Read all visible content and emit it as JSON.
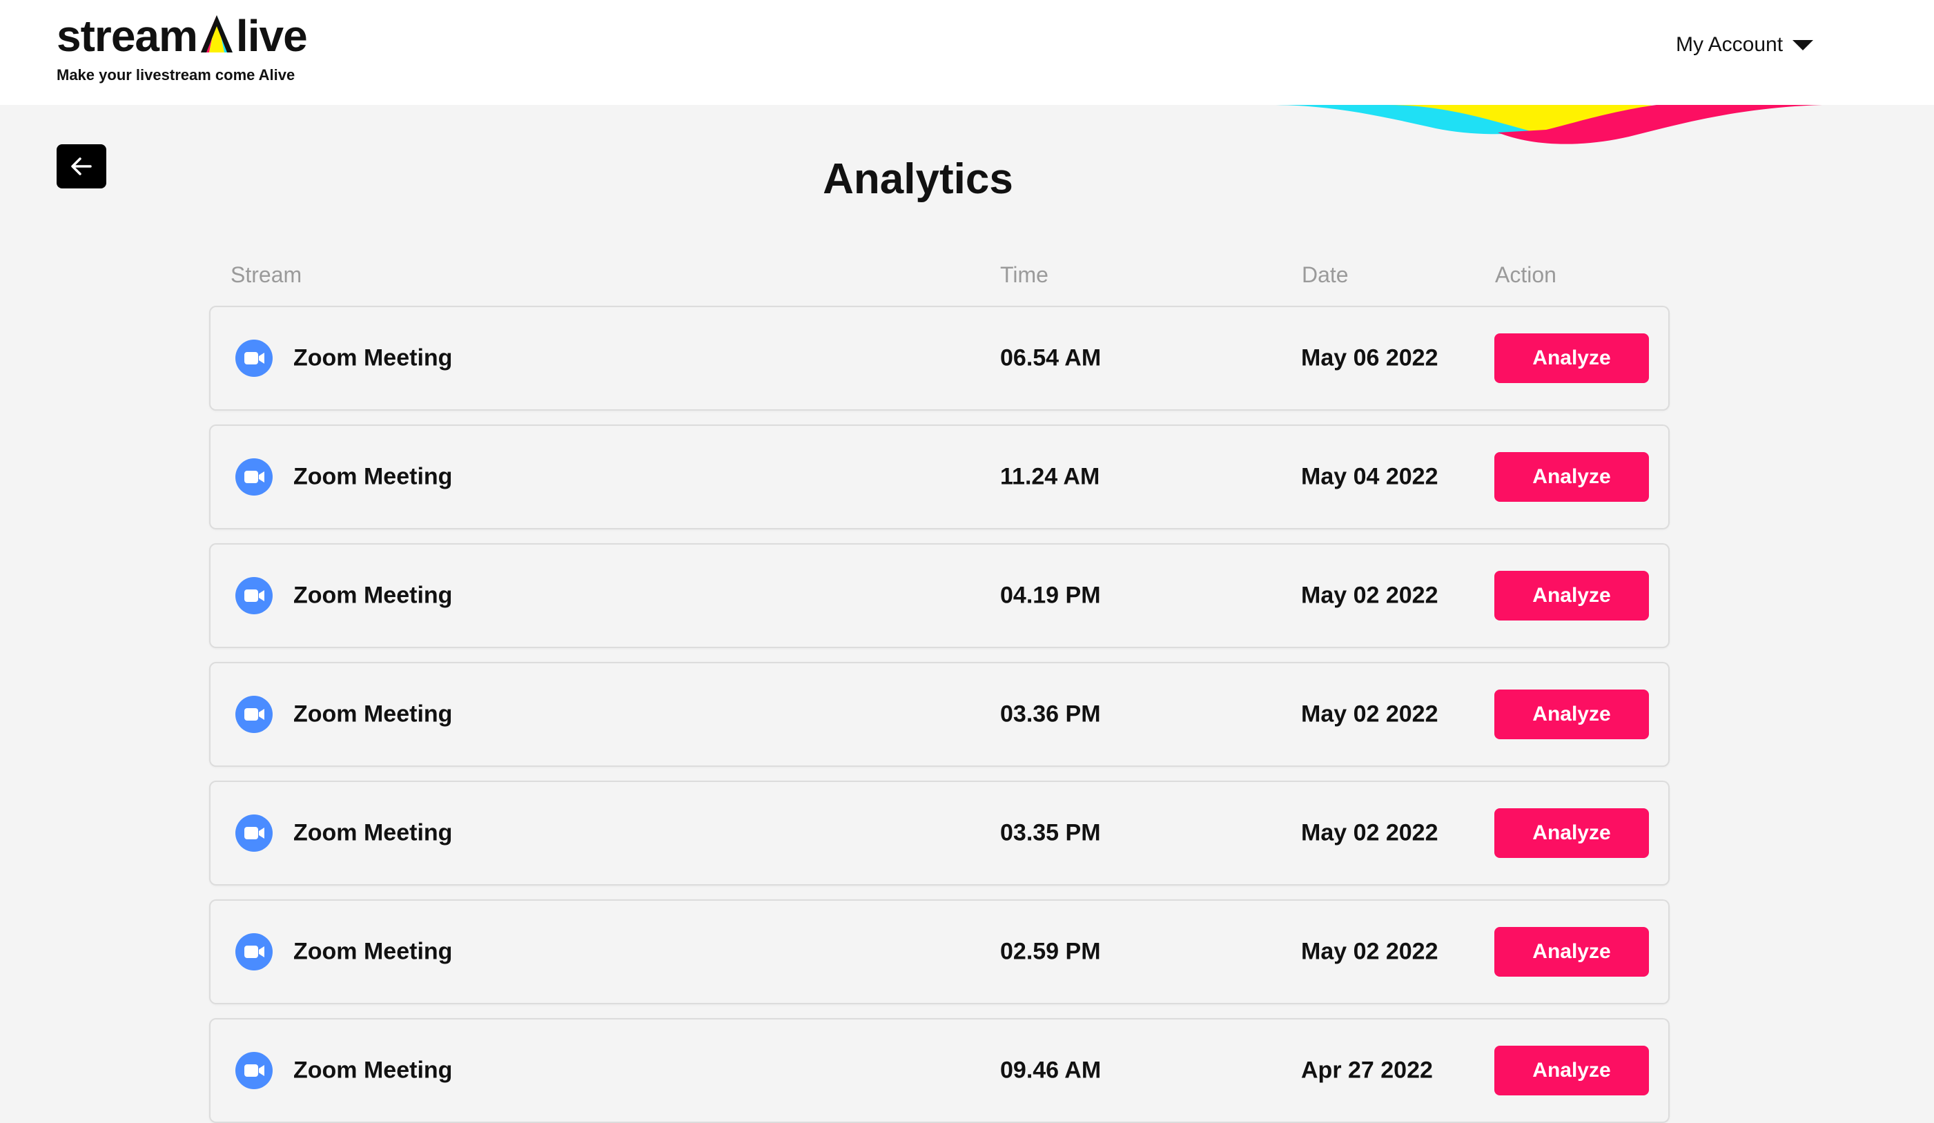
{
  "brand": {
    "logo_text_left": "stream",
    "logo_text_right": "live",
    "tagline": "Make your livestream come Alive",
    "colors": {
      "accent": "#fc0f62",
      "cyan": "#1fe0f5",
      "yellow": "#fff200",
      "zoom_blue": "#4a8cff"
    }
  },
  "header": {
    "account_label": "My Account",
    "account_icon": "caret-down-icon"
  },
  "nav": {
    "back_icon": "arrow-left-icon"
  },
  "page": {
    "title": "Analytics"
  },
  "table": {
    "columns": {
      "stream": "Stream",
      "time": "Time",
      "date": "Date",
      "action": "Action"
    },
    "rows": [
      {
        "name": "Zoom Meeting",
        "time": "06.54 AM",
        "date": "May 06 2022",
        "action": "Analyze",
        "icon": "zoom-icon"
      },
      {
        "name": "Zoom Meeting",
        "time": "11.24 AM",
        "date": "May 04 2022",
        "action": "Analyze",
        "icon": "zoom-icon"
      },
      {
        "name": "Zoom Meeting",
        "time": "04.19 PM",
        "date": "May 02 2022",
        "action": "Analyze",
        "icon": "zoom-icon"
      },
      {
        "name": "Zoom Meeting",
        "time": "03.36 PM",
        "date": "May 02 2022",
        "action": "Analyze",
        "icon": "zoom-icon"
      },
      {
        "name": "Zoom Meeting",
        "time": "03.35 PM",
        "date": "May 02 2022",
        "action": "Analyze",
        "icon": "zoom-icon"
      },
      {
        "name": "Zoom Meeting",
        "time": "02.59 PM",
        "date": "May 02 2022",
        "action": "Analyze",
        "icon": "zoom-icon"
      },
      {
        "name": "Zoom Meeting",
        "time": "09.46 AM",
        "date": "Apr 27 2022",
        "action": "Analyze",
        "icon": "zoom-icon"
      }
    ]
  }
}
